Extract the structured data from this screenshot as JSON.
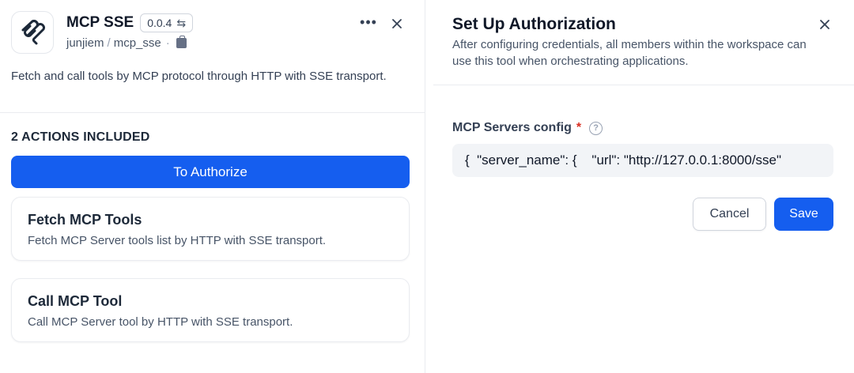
{
  "plugin": {
    "title": "MCP SSE",
    "version": "0.0.4",
    "author": "junjiem",
    "separator": "/",
    "package_name": "mcp_sse",
    "dot": "·",
    "description": "Fetch and call tools by MCP protocol through HTTP with SSE transport.",
    "icons": {
      "logo": "mcp-logo-icon",
      "version_switch": "swap-arrows-icon",
      "package": "package-icon",
      "more": "more-dots-icon",
      "close": "close-icon"
    }
  },
  "actions": {
    "heading": "2 ACTIONS INCLUDED",
    "authorize_label": "To Authorize",
    "items": [
      {
        "name": "Fetch MCP Tools",
        "description": "Fetch MCP Server tools list by HTTP with SSE transport."
      },
      {
        "name": "Call MCP Tool",
        "description": "Call MCP Server tool by HTTP with SSE transport."
      }
    ]
  },
  "auth_panel": {
    "title": "Set Up Authorization",
    "subtitle": "After configuring credentials, all members within the workspace can use this tool when orchestrating applications.",
    "field_label": "MCP Servers config",
    "required_mark": "*",
    "help_glyph": "?",
    "field_value": "{  \"server_name\": {    \"url\": \"http://127.0.0.1:8000/sse\"",
    "cancel_label": "Cancel",
    "save_label": "Save"
  },
  "colors": {
    "primary": "#155eef",
    "required": "#d92d20",
    "input_bg": "#f2f4f7",
    "border": "#eaecf0"
  }
}
